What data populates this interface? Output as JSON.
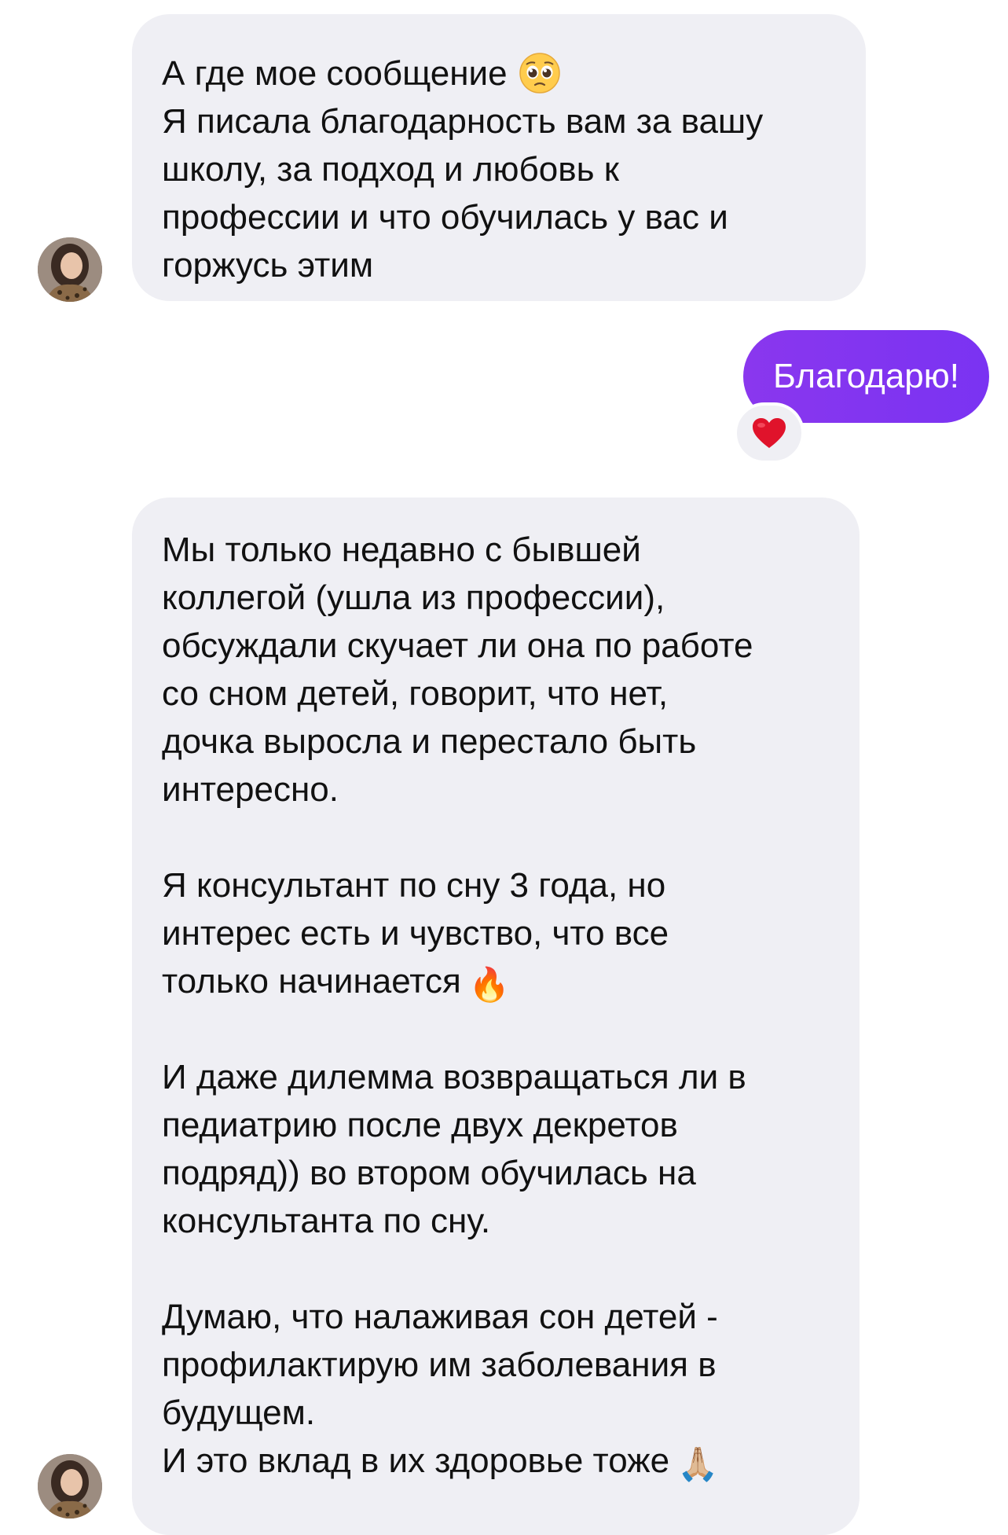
{
  "conversation": {
    "messages": [
      {
        "sender": "other",
        "text": "А где мое сообщение",
        "text_emoji": "pleading-face-emoji",
        "text_rest": "Я писала благодарность вам за вашу\nшколу, за подход и любовь к\nпрофессии и что обучилась у вас и\nгоржусь этим"
      },
      {
        "sender": "me",
        "text": "Благодарю!",
        "reaction": "❤️"
      },
      {
        "sender": "other",
        "paragraphs": [
          "Мы только недавно с бывшей\nколлегой (ушла из профессии),\nобсуждали скучает ли она по работе\nсо сном детей, говорит, что нет,\nдочка выросла и перестало быть\nинтересно.",
          "Я консультант по сну 3 года, но\nинтерес есть и чувство, что все\nтолько начинается",
          "И даже дилемма возвращаться ли в\nпедиатрию после двух  декретов\nподряд)) во втором обучилась на\nконсультанта по сну.",
          "Думаю, что налаживая сон детей -\nпрофилактирую им заболевания в\nбудущем.\nИ это вклад в их здоровье тоже"
        ],
        "emoji_fire": "🔥",
        "emoji_pray": "🙏🏼"
      }
    ]
  },
  "colors": {
    "incoming_bubble": "#efeff4",
    "outgoing_bubble": "#7d34f0",
    "text": "#111111"
  }
}
